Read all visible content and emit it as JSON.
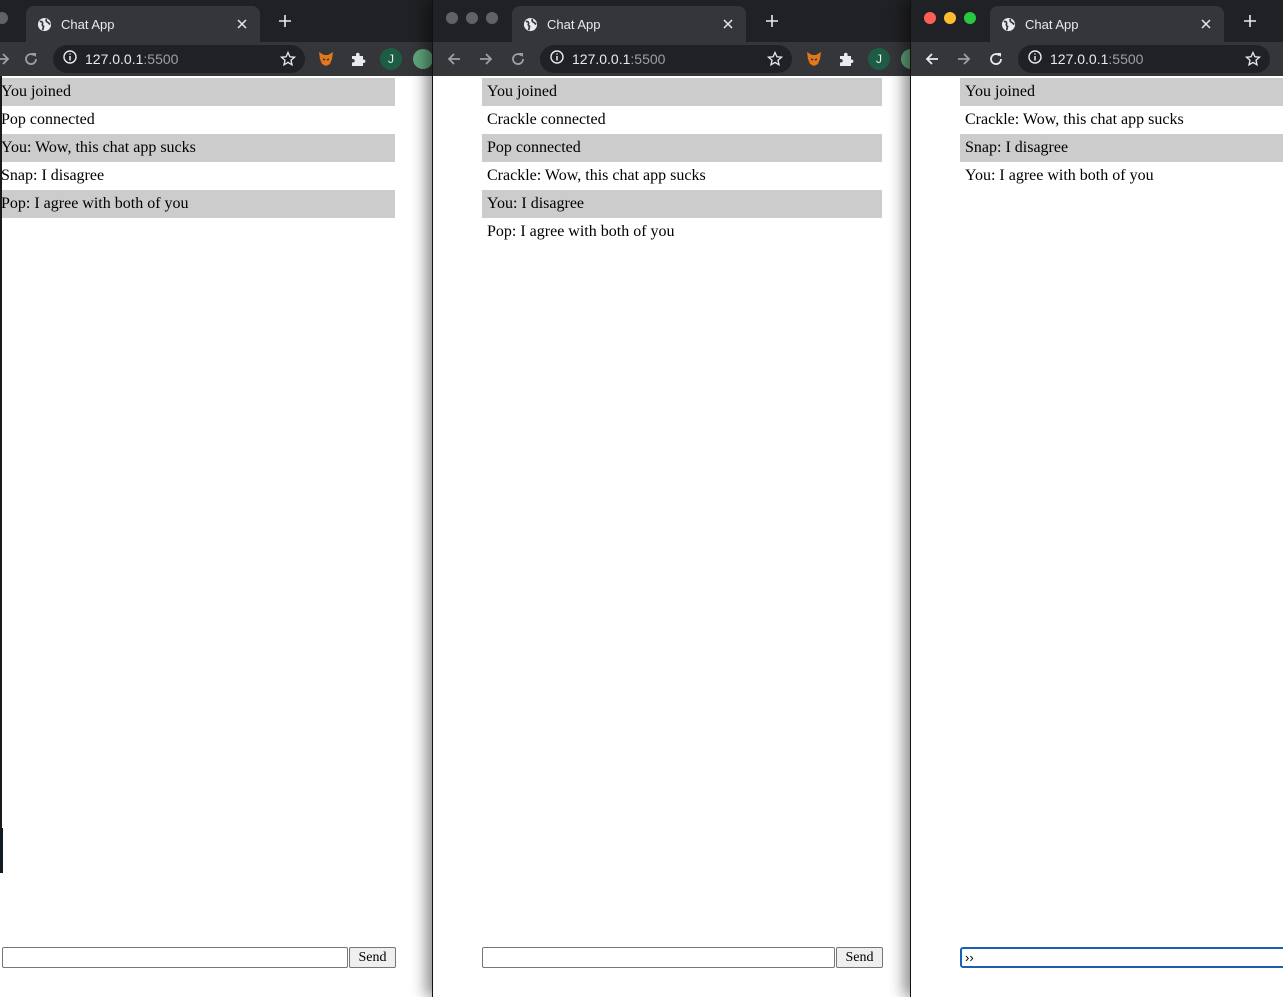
{
  "windows": [
    {
      "tab_title": "Chat App",
      "url_host": "127.0.0.1",
      "url_port": ":5500",
      "avatar_letter": "J",
      "messages": [
        "You joined",
        "Pop connected",
        "You: Wow, this chat app sucks",
        "Snap: I disagree",
        "Pop: I agree with both of you"
      ],
      "input_value": "",
      "send_label": "Send"
    },
    {
      "tab_title": "Chat App",
      "url_host": "127.0.0.1",
      "url_port": ":5500",
      "avatar_letter": "J",
      "messages": [
        "You joined",
        "Crackle connected",
        "Pop connected",
        "Crackle: Wow, this chat app sucks",
        "You: I disagree",
        "Pop: I agree with both of you"
      ],
      "input_value": "",
      "send_label": "Send"
    },
    {
      "tab_title": "Chat App",
      "url_host": "127.0.0.1",
      "url_port": ":5500",
      "messages": [
        "You joined",
        "Crackle: Wow, this chat app sucks",
        "Snap: I disagree",
        "You: I agree with both of you"
      ],
      "input_value": "››"
    }
  ],
  "colors": {
    "tabbar_bg": "#202124",
    "toolbar_bg": "#35363a",
    "message_alt_bg": "#cccccc",
    "focus_ring": "#1a5fb4"
  },
  "icons": {
    "favicon": "globe-icon",
    "close": "close-icon",
    "new_tab": "plus-icon",
    "back": "arrow-left-icon",
    "forward": "arrow-right-icon",
    "reload": "reload-icon",
    "site_info": "info-icon",
    "bookmark": "star-icon",
    "metamask": "fox-icon",
    "extensions": "puzzle-icon"
  }
}
